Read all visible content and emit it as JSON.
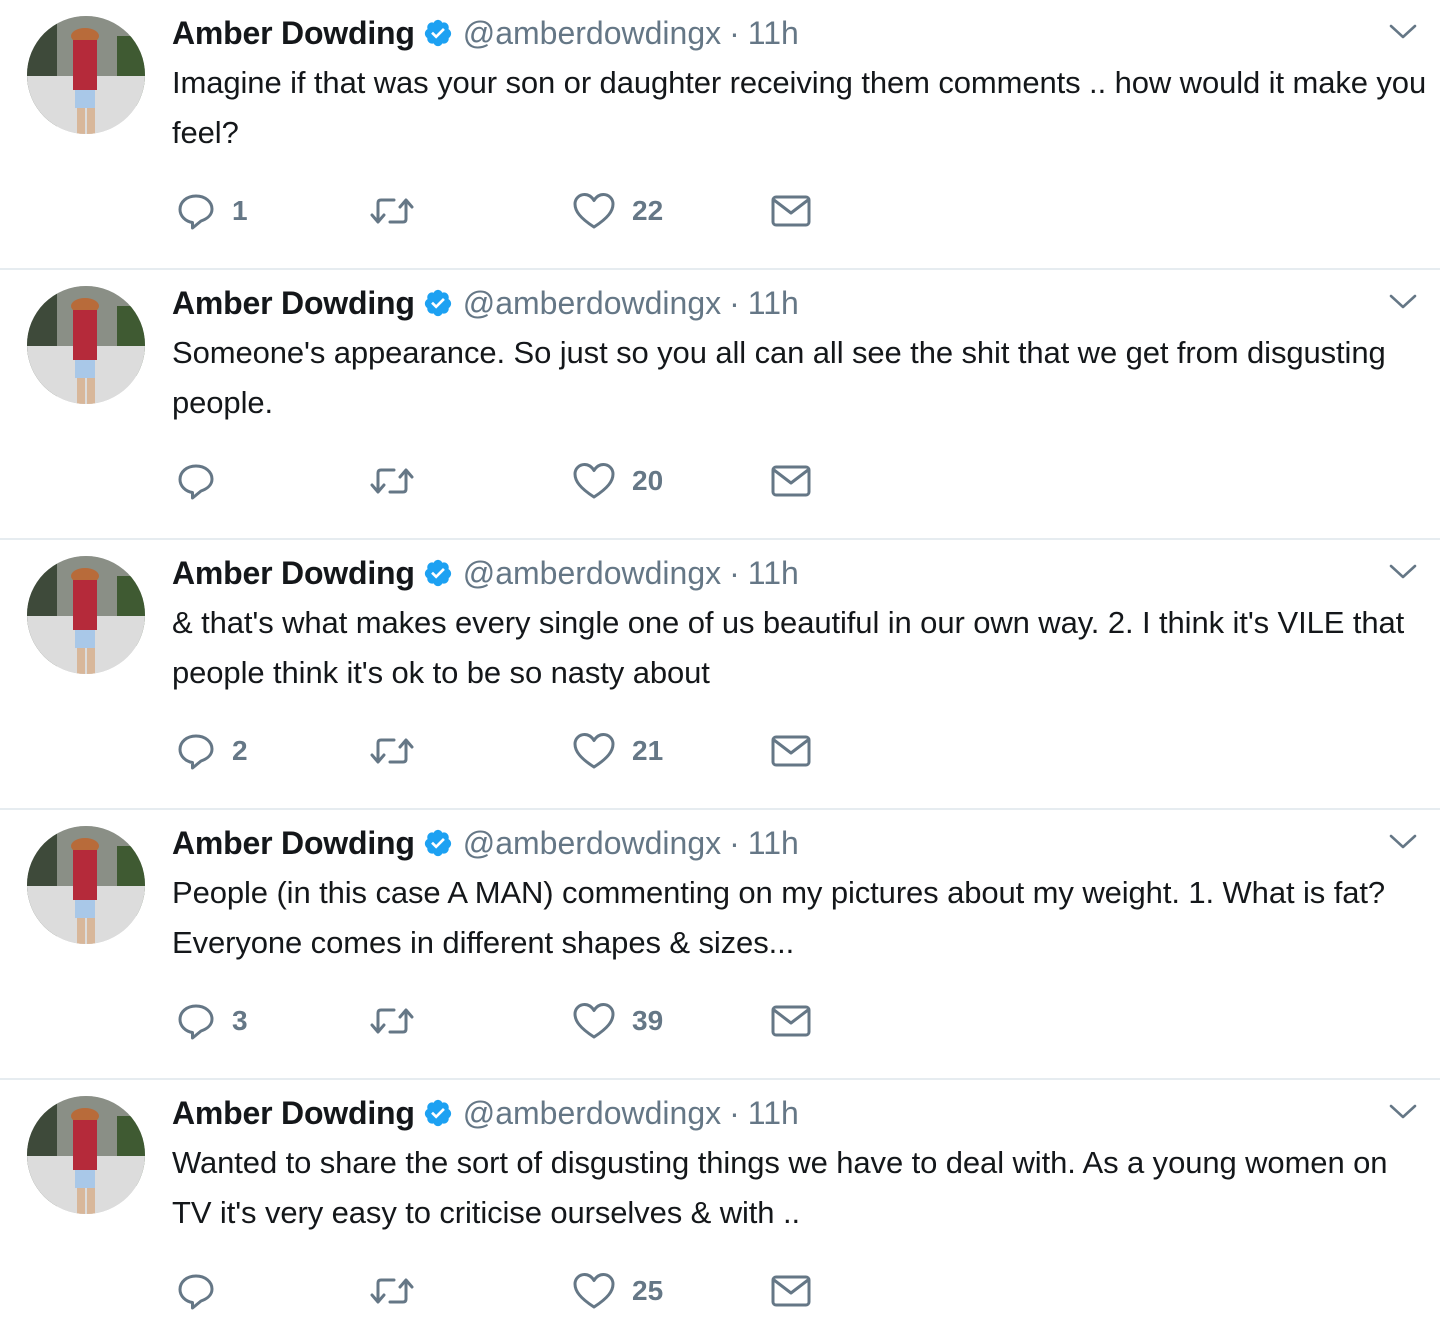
{
  "colors": {
    "accent": "#1da1f2",
    "text": "#14171a",
    "secondary": "#657786",
    "divider": "#e6ecf0"
  },
  "icons": {
    "reply": "reply-icon",
    "retweet": "retweet-icon",
    "like": "like-icon",
    "dm": "direct-message-icon",
    "verified": "verified-badge-icon",
    "caret": "chevron-down-icon"
  },
  "tweets": [
    {
      "name": "Amber Dowding",
      "handle": "@amberdowdingx",
      "separator": "·",
      "time": "11h",
      "text": "Imagine if that was your son or daughter receiving them comments .. how would it make you feel?",
      "replies": "1",
      "retweets": "",
      "likes": "22"
    },
    {
      "name": "Amber Dowding",
      "handle": "@amberdowdingx",
      "separator": "·",
      "time": "11h",
      "text": "Someone's appearance. So just so you all can all see the shit that we get from disgusting people.",
      "replies": "",
      "retweets": "",
      "likes": "20"
    },
    {
      "name": "Amber Dowding",
      "handle": "@amberdowdingx",
      "separator": "·",
      "time": "11h",
      "text": "& that's what makes every single one of us beautiful in our own way. 2. I think it's VILE that people think it's ok to be so nasty about",
      "replies": "2",
      "retweets": "",
      "likes": "21"
    },
    {
      "name": "Amber Dowding",
      "handle": "@amberdowdingx",
      "separator": "·",
      "time": "11h",
      "text": "People (in this case A MAN) commenting on my pictures about my weight. 1. What is fat? Everyone comes in different shapes & sizes...",
      "replies": "3",
      "retweets": "",
      "likes": "39"
    },
    {
      "name": "Amber Dowding",
      "handle": "@amberdowdingx",
      "separator": "·",
      "time": "11h",
      "text": "Wanted to share the sort of disgusting things we have to deal with. As a young women on TV it's very easy to criticise ourselves & with ..",
      "replies": "",
      "retweets": "",
      "likes": "25"
    }
  ]
}
